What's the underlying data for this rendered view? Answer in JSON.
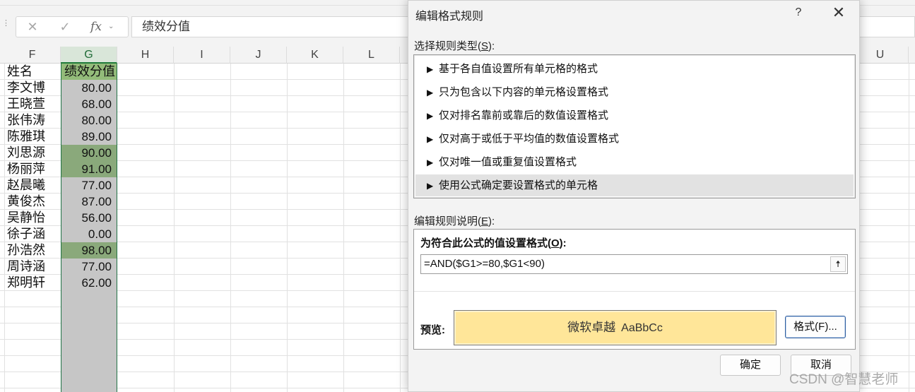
{
  "formula_bar": {
    "cancel_icon": "✕",
    "enter_icon": "✓",
    "function_icon": "fx",
    "chevron_icon": "⌄",
    "content": "绩效分值"
  },
  "columns": [
    "F",
    "G",
    "H",
    "I",
    "J",
    "K",
    "L",
    "U"
  ],
  "selected_column": "G",
  "sheet": {
    "header": [
      "姓名",
      "绩效分值"
    ],
    "rows": [
      {
        "name": "李文博",
        "score": "80.00",
        "highlight": false
      },
      {
        "name": "王晓萱",
        "score": "68.00",
        "highlight": false
      },
      {
        "name": "张伟涛",
        "score": "80.00",
        "highlight": false
      },
      {
        "name": "陈雅琪",
        "score": "89.00",
        "highlight": false
      },
      {
        "name": "刘思源",
        "score": "90.00",
        "highlight": true
      },
      {
        "name": "杨丽萍",
        "score": "91.00",
        "highlight": true
      },
      {
        "name": "赵晨曦",
        "score": "77.00",
        "highlight": false
      },
      {
        "name": "黄俊杰",
        "score": "87.00",
        "highlight": false
      },
      {
        "name": "吴静怡",
        "score": "56.00",
        "highlight": false
      },
      {
        "name": "徐子涵",
        "score": "0.00",
        "highlight": false
      },
      {
        "name": "孙浩然",
        "score": "98.00",
        "highlight": true
      },
      {
        "name": "周诗涵",
        "score": "77.00",
        "highlight": false
      },
      {
        "name": "郑明轩",
        "score": "62.00",
        "highlight": false
      }
    ]
  },
  "dialog": {
    "title": "编辑格式规则",
    "help_icon": "?",
    "close_icon": "✕",
    "select_type_label": "选择规则类型(S):",
    "select_type_text": "选择规则类型(",
    "select_type_key": "S",
    "select_type_end": "):",
    "rule_types": [
      "基于各自值设置所有单元格的格式",
      "只为包含以下内容的单元格设置格式",
      "仅对排名靠前或靠后的数值设置格式",
      "仅对高于或低于平均值的数值设置格式",
      "仅对唯一值或重复值设置格式",
      "使用公式确定要设置格式的单元格"
    ],
    "selected_rule_index": 5,
    "rule_arrow_icon": "▶",
    "edit_desc_text": "编辑规则说明(",
    "edit_desc_key": "E",
    "edit_desc_end": "):",
    "format_values_text": "为符合此公式的值设置格式(",
    "format_values_key": "O",
    "format_values_end": "):",
    "formula": "=AND($G1>=80,$G1<90)",
    "collapse_icon": "🠅",
    "preview_label": "预览:",
    "preview_zh": "微软卓越",
    "preview_en": "AaBbCc",
    "preview_fill": "#ffe699",
    "format_button": "格式(F)...",
    "ok_button": "确定",
    "cancel_button": "取消"
  },
  "highlight_color": "#8aa97b",
  "watermark": "CSDN @智慧老师"
}
